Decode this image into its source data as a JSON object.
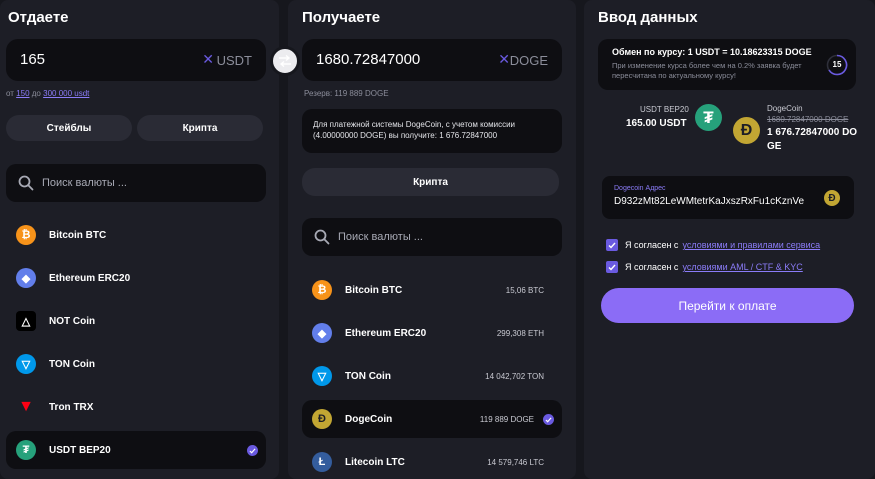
{
  "give": {
    "title": "Отдаете",
    "amount": "165",
    "currency": "USDT",
    "limits": {
      "from_prefix": "от",
      "min": "150",
      "to_prefix": "до",
      "max": "300 000 usdt"
    },
    "tabs": [
      "Стейблы",
      "Крипта"
    ],
    "search_placeholder": "Поиск валюты ...",
    "coins": [
      {
        "name": "Bitcoin BTC",
        "icon": "bitcoin-icon",
        "color": "#f7931a",
        "glyph": "₿"
      },
      {
        "name": "Ethereum ERC20",
        "icon": "ethereum-icon",
        "color": "#627eea",
        "glyph": "◆"
      },
      {
        "name": "NOT Coin",
        "icon": "notcoin-icon",
        "color": "#000000",
        "glyph": "△"
      },
      {
        "name": "TON Coin",
        "icon": "ton-icon",
        "color": "#0098ea",
        "glyph": "▽"
      },
      {
        "name": "Tron TRX",
        "icon": "tron-icon",
        "color": "#ff0013",
        "glyph": "▼"
      },
      {
        "name": "USDT BEP20",
        "icon": "tether-icon",
        "color": "#26a17b",
        "glyph": "₮",
        "selected": true
      }
    ]
  },
  "get": {
    "title": "Получаете",
    "amount": "1680.72847000",
    "currency": "DOGE",
    "reserve": "Резерв: 119 889 DOGE",
    "info": "Для платежной системы DogeCoin, с учетом комиссии (4.00000000 DOGE) вы получите: 1 676.72847000",
    "tab": "Крипта",
    "search_placeholder": "Поиск валюты ...",
    "coins": [
      {
        "name": "Bitcoin BTC",
        "balance": "15,06 BTC",
        "icon": "bitcoin-icon",
        "color": "#f7931a",
        "glyph": "₿"
      },
      {
        "name": "Ethereum ERC20",
        "balance": "299,308 ETH",
        "icon": "ethereum-icon",
        "color": "#627eea",
        "glyph": "◆"
      },
      {
        "name": "TON Coin",
        "balance": "14 042,702 TON",
        "icon": "ton-icon",
        "color": "#0098ea",
        "glyph": "▽"
      },
      {
        "name": "DogeCoin",
        "balance": "119 889 DOGE",
        "icon": "dogecoin-icon",
        "color": "#c2a633",
        "glyph": "Ð",
        "selected": true
      },
      {
        "name": "Litecoin LTC",
        "balance": "14 579,746 LTC",
        "icon": "litecoin-icon",
        "color": "#345d9d",
        "glyph": "Ł"
      }
    ]
  },
  "data": {
    "title": "Ввод данных",
    "rate_title": "Обмен по курсу: 1 USDT = 10.18623315 DOGE",
    "rate_note": "При изменение курса более чем на 0.2% заявка будет пересчитана по актуальному курсу!",
    "timer": "15",
    "from_label": "USDT BEP20",
    "from_value": "165.00 USDT",
    "to_label": "DogeCoin",
    "to_old": "1680.72847000 DOGE",
    "to_value": "1 676.72847000 DO",
    "to_value_2": "GE",
    "address_label": "Dogecoin Адрес",
    "address": "D932zMt82LeWMtetrKaJxszRxFu1cKznVe",
    "agree_prefix": "Я согласен с",
    "agree1_link": "условиями и правилами сервиса",
    "agree2_link": "условиями AML / CTF & KYC",
    "pay_button": "Перейти к оплате"
  },
  "colors": {
    "accent": "#6a5ae0",
    "button": "#8b6cf6",
    "panel": "#1d1e26",
    "input": "#0e0e12"
  }
}
